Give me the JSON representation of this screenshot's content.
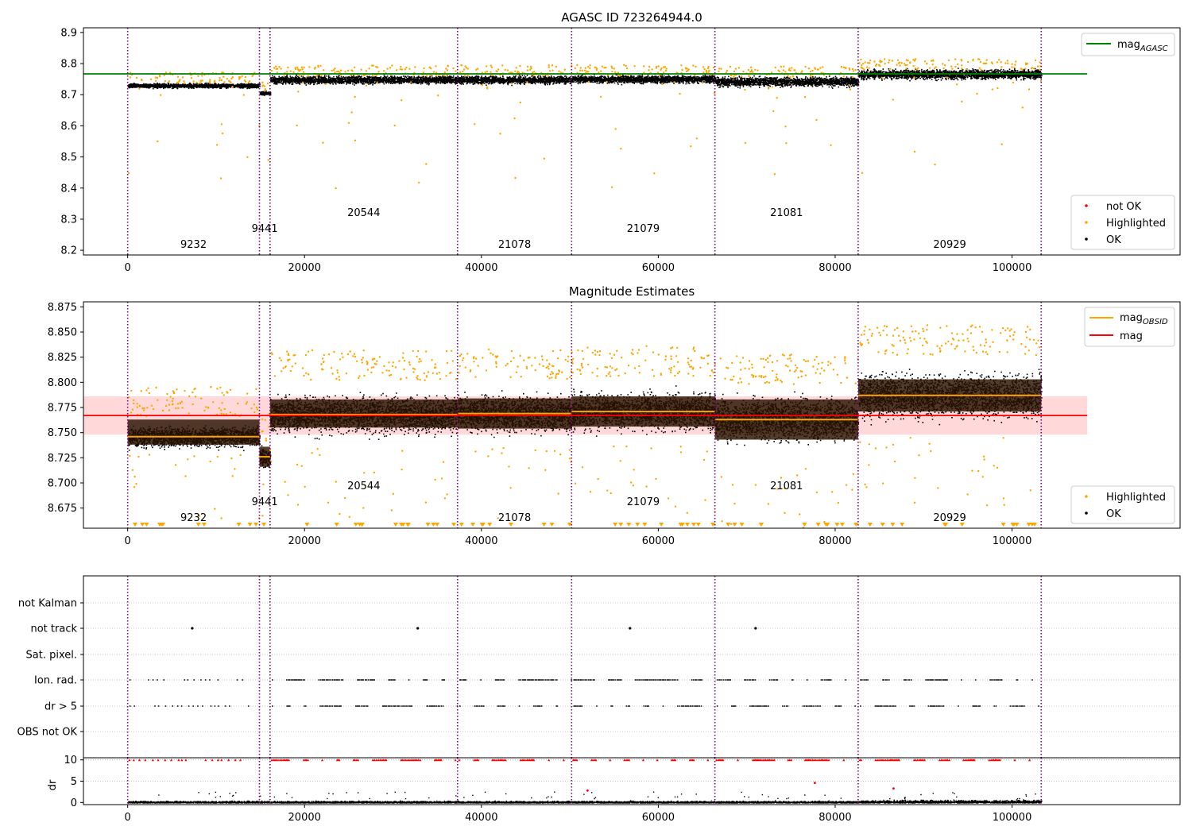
{
  "colors": {
    "ok": "#000000",
    "highlighted": "#ffa500",
    "not_ok": "#ff0000",
    "agasc_line": "#008000",
    "mag_line": "#ff0000",
    "mag_band": "#ffcccc",
    "obsid_line": "#ffa500",
    "obsid_box": "#2a1200",
    "boundary": "#800080"
  },
  "chart_data": [
    {
      "id": "agasc",
      "type": "scatter",
      "title": "AGASC ID 723264944.0",
      "xlim": [
        -5000,
        119000
      ],
      "ylim": [
        8.185,
        8.915
      ],
      "x_ticks": [
        0,
        20000,
        40000,
        60000,
        80000,
        100000
      ],
      "y_ticks": [
        8.2,
        8.3,
        8.4,
        8.5,
        8.6,
        8.7,
        8.8,
        8.9
      ],
      "agasc_mag": 8.767,
      "agasc_line_range": [
        -5000,
        108500
      ],
      "legend_top": [
        "mag_AGASC"
      ],
      "legend_bottom": [
        "not OK",
        "Highlighted",
        "OK"
      ]
    },
    {
      "id": "estimates",
      "type": "scatter",
      "title": "Magnitude Estimates",
      "xlim": [
        -5000,
        119000
      ],
      "ylim": [
        8.655,
        8.88
      ],
      "x_ticks": [
        0,
        20000,
        40000,
        60000,
        80000,
        100000
      ],
      "y_ticks": [
        8.675,
        8.7,
        8.725,
        8.75,
        8.775,
        8.8,
        8.825,
        8.85,
        8.875
      ],
      "mag": 8.767,
      "mag_band": [
        8.748,
        8.786
      ],
      "mag_line_range": [
        -5000,
        108500
      ],
      "legend_top": [
        "mag_OBSID",
        "mag"
      ],
      "legend_bottom": [
        "Highlighted",
        "OK"
      ]
    },
    {
      "id": "flags",
      "type": "scatter",
      "xlim": [
        -5000,
        119000
      ],
      "y_categories": [
        "not Kalman",
        "not track",
        "Sat. pixel.",
        "Ion. rad.",
        "dr > 5",
        "OBS not OK"
      ],
      "not_track_x": [
        7300,
        32800,
        56800,
        71000
      ]
    },
    {
      "id": "dr",
      "type": "scatter",
      "ylabel": "dr",
      "xlim": [
        -5000,
        119000
      ],
      "ylim": [
        -0.5,
        10.5
      ],
      "x_ticks": [
        0,
        20000,
        40000,
        60000,
        80000,
        100000
      ],
      "y_ticks": [
        0,
        5,
        10
      ],
      "red_outliers": [
        [
          52000,
          2.8
        ],
        [
          77700,
          4.6
        ],
        [
          86600,
          3.3
        ]
      ]
    }
  ],
  "observations": [
    {
      "obsid": "9232",
      "start": 0,
      "end": 14900,
      "mag": 8.746,
      "box": [
        8.738,
        8.763
      ],
      "scatter": [
        8.728,
        8.766
      ],
      "label_row": 0
    },
    {
      "obsid": "9441",
      "start": 14900,
      "end": 16100,
      "mag": 8.726,
      "box": [
        8.716,
        8.736
      ],
      "scatter": [
        8.708,
        8.742
      ],
      "label_row": 1
    },
    {
      "obsid": "20544",
      "start": 16100,
      "end": 37300,
      "mag": 8.768,
      "box": [
        8.755,
        8.783
      ],
      "scatter": [
        8.734,
        8.802
      ],
      "label_row": 2
    },
    {
      "obsid": "21078",
      "start": 37300,
      "end": 50200,
      "mag": 8.769,
      "box": [
        8.754,
        8.784
      ],
      "scatter": [
        8.735,
        8.803
      ],
      "label_row": 0
    },
    {
      "obsid": "21079",
      "start": 50200,
      "end": 66400,
      "mag": 8.771,
      "box": [
        8.756,
        8.786
      ],
      "scatter": [
        8.738,
        8.806
      ],
      "label_row": 1
    },
    {
      "obsid": "21081",
      "start": 66400,
      "end": 82600,
      "mag": 8.763,
      "box": [
        8.743,
        8.783
      ],
      "scatter": [
        8.718,
        8.798
      ],
      "label_row": 2
    },
    {
      "obsid": "20929",
      "start": 82600,
      "end": 103300,
      "mag": 8.787,
      "box": [
        8.771,
        8.803
      ],
      "scatter": [
        8.745,
        8.827
      ],
      "label_row": 0
    }
  ],
  "legend": {
    "mag_agasc_main": "mag",
    "mag_agasc_sub": "AGASC",
    "mag_obsid_main": "mag",
    "mag_obsid_sub": "OBSID",
    "mag": "mag",
    "not_ok": "not OK",
    "highlighted": "Highlighted",
    "ok": "OK"
  }
}
